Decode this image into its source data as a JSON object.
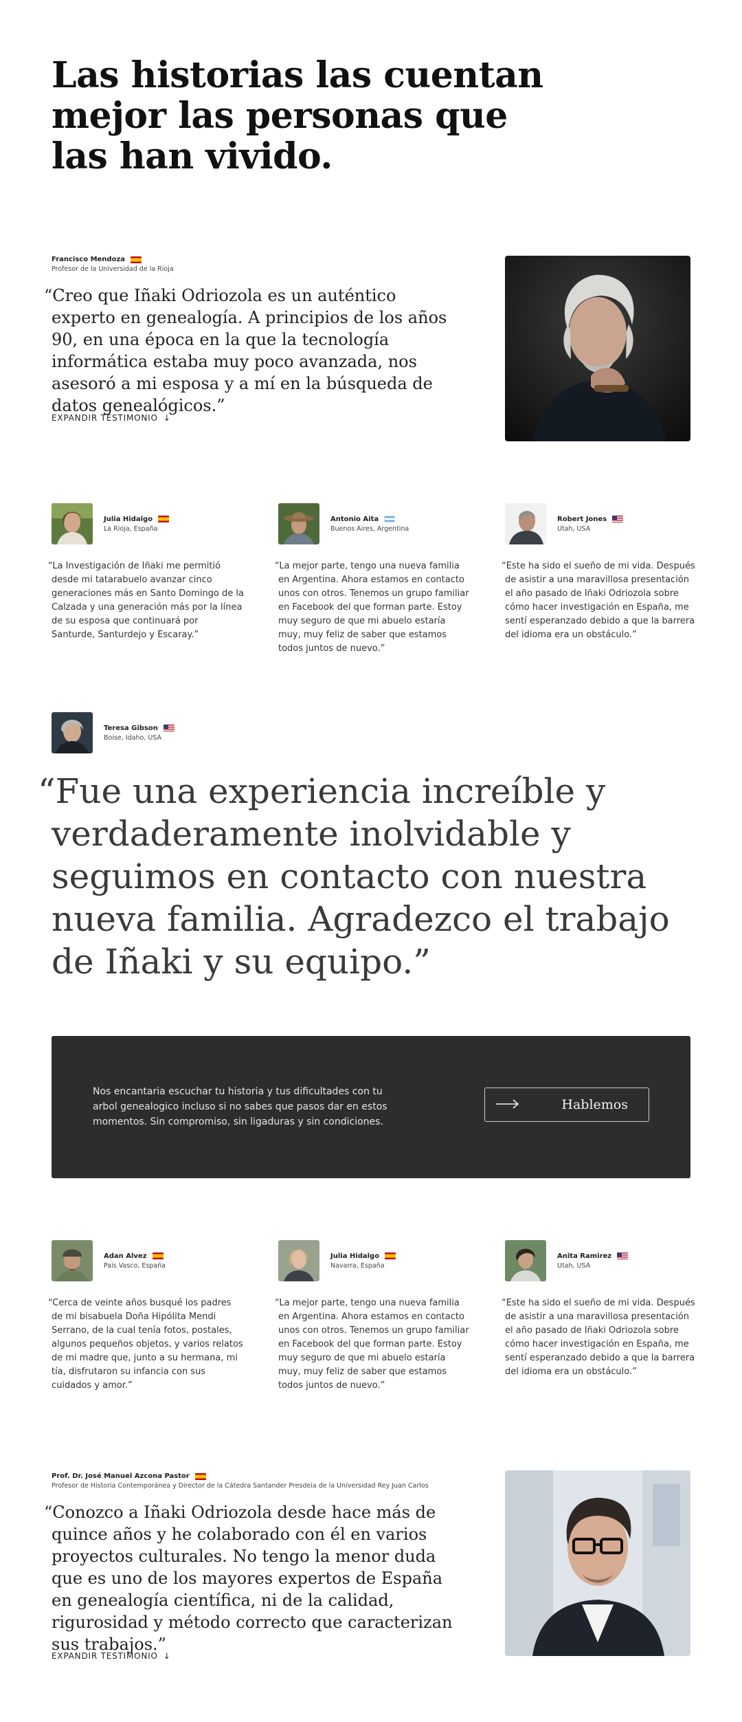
{
  "hero": {
    "title": "Las historias las cuentan mejor las personas que las han vivido."
  },
  "testimonial_top": {
    "name": "Francisco Mendoza",
    "flag": "es",
    "role": "Profesor de la Universidad de la Rioja",
    "quote": "“Creo que Iñaki Odriozola es un auténtico experto en genealogía. A principios de los años 90, en una época en la que la tecnología informática estaba muy poco avanzada, nos asesoró a mi esposa y a mí en la búsqueda de datos genealógicos.”",
    "expand_label": "EXPANDIR TESTIMONIO",
    "expand_icon": "arrow-down-icon"
  },
  "cards_row1": [
    {
      "name": "Julia Hidalgo",
      "flag": "es",
      "location": "La Rioja, España",
      "text": "“La Investigación de Iñaki me permitió desde mi tatarabuelo avanzar cinco generaciones más en Santo Domingo de la Calzada y una generación más por la línea de su esposa que continuará por Santurde, Santurdejo y Escaray.”"
    },
    {
      "name": "Antonio Aita",
      "flag": "ar",
      "location": "Buenos Aires, Argentina",
      "text": "“La mejor parte, tengo una nueva familia en Argentina. Ahora estamos en contacto unos con otros. Tenemos un grupo familiar en Facebook del que forman parte. Estoy muy seguro de que mi abuelo estaría muy, muy feliz de saber que estamos todos juntos de nuevo.”"
    },
    {
      "name": "Robert Jones",
      "flag": "us",
      "location": "Utah, USA",
      "text": "“Este ha sido el sueño de mi vida. Después de asistir a una maravillosa presentación el año pasado de Iñaki Odriozola sobre cómo hacer investigación en España, me sentí esperanzado debido a que la barrera del idioma era un obstáculo.”"
    }
  ],
  "featured": {
    "name": "Teresa Gibson",
    "flag": "us",
    "location": "Boise, Idaho, USA",
    "quote": "“Fue una experiencia increíble y verdaderamente inolvidable y seguimos en contacto con nuestra nueva familia. Agradezco el trabajo de Iñaki y su equipo.”"
  },
  "cta": {
    "text": "Nos encantaria escuchar tu historia y tus dificultades con tu arbol genealogico incluso si no sabes que pasos dar en estos momentos. Sin compromiso, sin ligaduras y sin condiciones.",
    "button_label": "Hablemos",
    "button_icon": "arrow-right-icon"
  },
  "cards_row2": [
    {
      "name": "Adan Alvez",
      "flag": "es",
      "location": "País Vasco, España",
      "text": "“Cerca de veinte años busqué los padres de mi bisabuela Doña Hipólita Mendi Serrano, de la cual tenía fotos, postales, algunos pequeños objetos, y varios relatos de mi madre que, junto a su hermana, mi tía, disfrutaron su infancia con sus cuidados y amor.”"
    },
    {
      "name": "Julia Hidalgo",
      "flag": "es",
      "location": "Navarra, España",
      "text": "“La mejor parte, tengo una nueva familia en Argentina. Ahora estamos en contacto unos con otros. Tenemos un grupo familiar en Facebook del que forman parte. Estoy muy seguro de que mi abuelo estaría muy, muy feliz de saber que estamos todos juntos de nuevo.”"
    },
    {
      "name": "Anita Ramirez",
      "flag": "us",
      "location": "Utah, USA",
      "text": "“Este ha sido el sueño de mi vida. Después de asistir a una maravillosa presentación el año pasado de Iñaki Odriozola sobre cómo hacer investigación en España, me sentí esperanzado debido a que la barrera del idioma era un obstáculo.”"
    }
  ],
  "testimonial_bottom": {
    "name": "Prof. Dr. José Manuel Azcona Pastor",
    "flag": "es",
    "role": "Profesor de Historia Contemporánea y Director de la Cátedra Santander Presdeia de la Universidad Rey Juan Carlos",
    "quote": "“Conozco a Iñaki Odriozola desde hace más de quince años y he colaborado con él en varios proyectos culturales. No tengo la menor duda que es uno de los mayores expertos de España en genealogía científica, ni de la calidad, rigurosidad y método correcto que caracterizan sus trabajos.”",
    "expand_label": "EXPANDIR TESTIMONIO",
    "expand_icon": "arrow-down-icon"
  }
}
